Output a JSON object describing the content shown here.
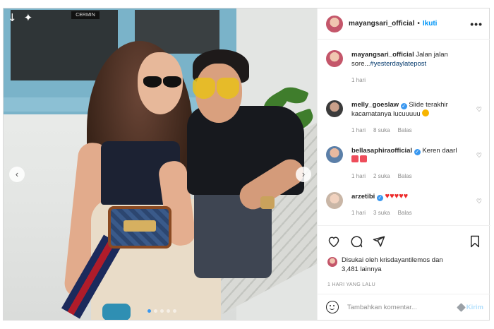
{
  "post": {
    "username": "mayangsari_official",
    "separator": "•",
    "follow_label": "Ikuti",
    "more_label": "•••"
  },
  "photo": {
    "prev_arrow": "‹",
    "next_arrow": "›",
    "carousel_count": 5,
    "active_index": 0,
    "store_sign": "CERMIN"
  },
  "caption": {
    "username": "mayangsari_official",
    "text": "Jalan jalan sore...",
    "hashtag": "#yesterdaylatepost",
    "time": "1 hari"
  },
  "comments": [
    {
      "username": "melly_goeslaw",
      "verified": true,
      "text": "Slide terakhir kacamatanya lucuuuuu",
      "emoji": "heart-eyes-emoji",
      "time": "1 hari",
      "likes": "8 suka",
      "reply_label": "Balas"
    },
    {
      "username": "bellasaphiraofficial",
      "verified": true,
      "text": "Keren daarl",
      "emoji": "heart-box-emoji",
      "time": "1 hari",
      "likes": "2 suka",
      "reply_label": "Balas"
    },
    {
      "username": "arzetibi",
      "verified": true,
      "text": "♥♥♥♥♥",
      "time": "1 hari",
      "likes": "3 suka",
      "reply_label": "Balas"
    }
  ],
  "likes": {
    "prefix": "Disukai oleh",
    "by": "krisdayantilemos",
    "and": "dan",
    "count": "3,481 lainnya"
  },
  "post_date": "1 HARI YANG LALU",
  "add_comment": {
    "placeholder": "Tambahkan komentar...",
    "post_label": "Kirim"
  },
  "icons": {
    "like": "heart-icon",
    "comment": "comment-icon",
    "share": "share-icon",
    "save": "bookmark-icon",
    "emoji": "emoji-icon"
  },
  "colors": {
    "link_blue": "#0095f6",
    "verified_blue": "#3897f0",
    "muted_text": "#8e8e8e",
    "heart_red": "#ed2a2a"
  }
}
